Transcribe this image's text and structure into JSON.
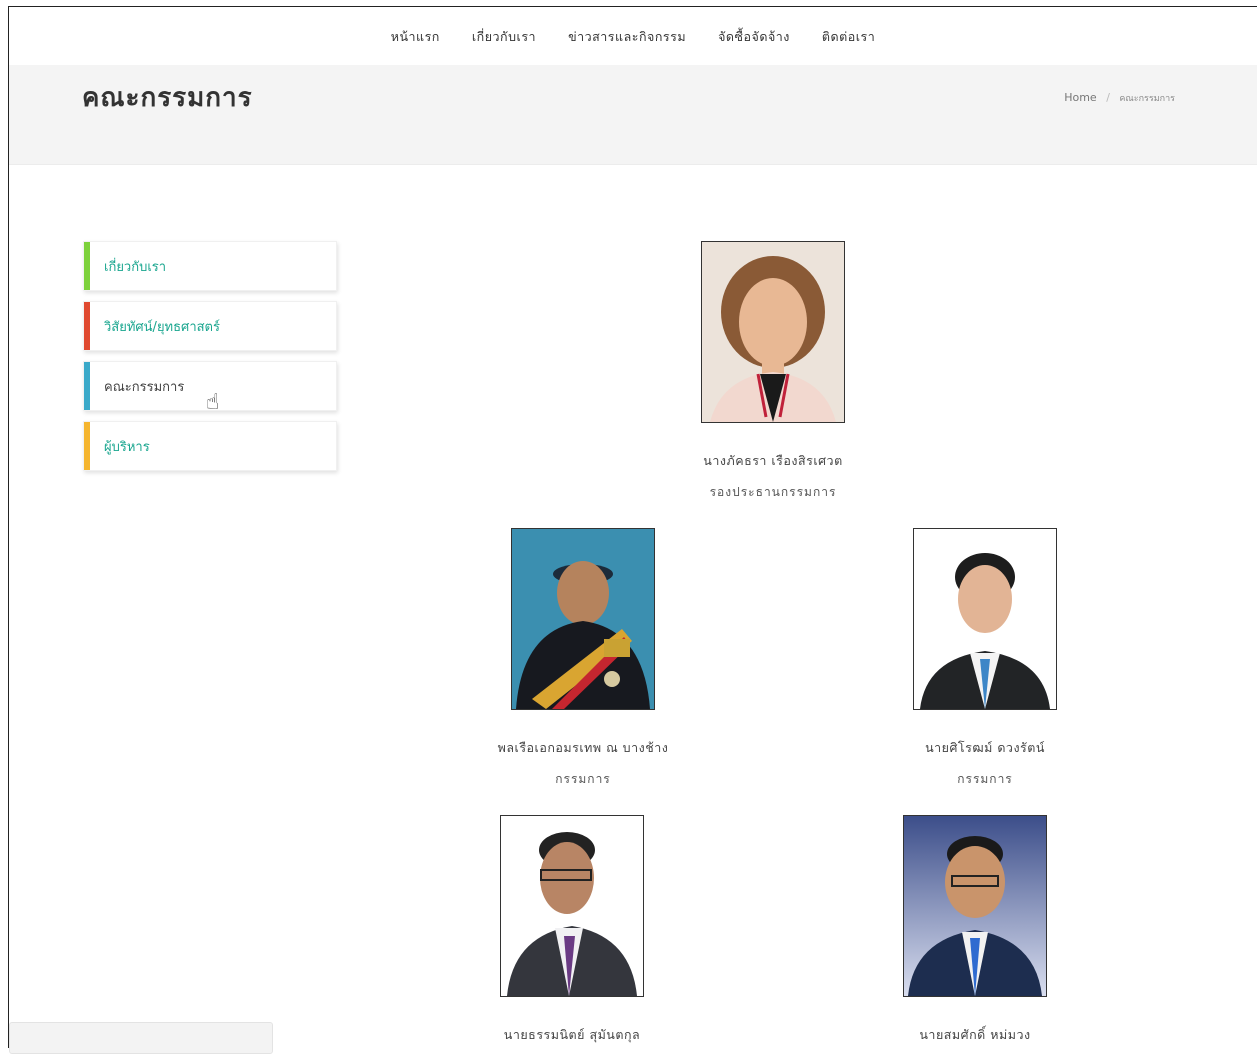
{
  "nav": {
    "items": [
      "หน้าแรก",
      "เกี่ยวกับเรา",
      "ข่าวสารและกิจกรรม",
      "จัดซื้อจัดจ้าง",
      "ติดต่อเรา"
    ]
  },
  "header": {
    "title": "คณะกรรมการ",
    "breadcrumb": {
      "home": "Home",
      "separator": "/",
      "current": "คณะกรรมการ"
    }
  },
  "sidebar": {
    "items": [
      {
        "label": "เกี่ยวกับเรา",
        "color": "#7dd13b"
      },
      {
        "label": "วิสัยทัศน์/ยุทธศาสตร์",
        "color": "#e0492f"
      },
      {
        "label": "คณะกรรมการ",
        "color": "#3aa9c9"
      },
      {
        "label": "ผู้บริหาร",
        "color": "#f5b52e"
      }
    ]
  },
  "members": [
    {
      "name": "นางภัคธรา เรืองสิรเศวต",
      "role": "รองประธานกรรมการ"
    },
    {
      "name": "พลเรือเอกอมรเทพ ณ บางช้าง",
      "role": "กรรมการ"
    },
    {
      "name": "นายศิโรฒม์ ดวงรัตน์",
      "role": "กรรมการ"
    },
    {
      "name": "นายธรรมนิตย์ สุมันตกุล",
      "role": ""
    },
    {
      "name": "นายสมศักดิ์ หม่มวง",
      "role": ""
    }
  ],
  "colors": {
    "accent": "#1aa68f"
  }
}
